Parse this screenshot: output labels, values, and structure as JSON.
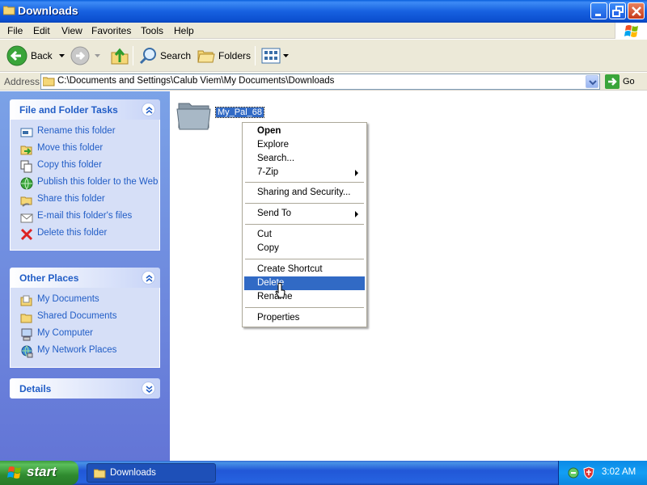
{
  "window": {
    "title": "Downloads",
    "buttons": {
      "minimize": "minimize-icon",
      "maximize": "restore-icon",
      "close": "close-icon"
    }
  },
  "menubar": {
    "items": [
      "File",
      "Edit",
      "View",
      "Favorites",
      "Tools",
      "Help"
    ]
  },
  "toolbar": {
    "back_label": "Back",
    "search_label": "Search",
    "folders_label": "Folders"
  },
  "address": {
    "label": "Address",
    "value": "C:\\Documents and Settings\\Calub Viem\\My Documents\\Downloads",
    "go_label": "Go"
  },
  "tasks": {
    "file_folder": {
      "title": "File and Folder Tasks",
      "items": [
        {
          "label": "Rename this folder",
          "icon": "rename-icon"
        },
        {
          "label": "Move this folder",
          "icon": "move-icon"
        },
        {
          "label": "Copy this folder",
          "icon": "copy-icon"
        },
        {
          "label": "Publish this folder to the Web",
          "icon": "globe-icon"
        },
        {
          "label": "Share this folder",
          "icon": "share-icon"
        },
        {
          "label": "E-mail this folder's files",
          "icon": "email-icon"
        },
        {
          "label": "Delete this folder",
          "icon": "delete-icon"
        }
      ]
    },
    "other_places": {
      "title": "Other Places",
      "items": [
        {
          "label": "My Documents",
          "icon": "folder-icon"
        },
        {
          "label": "Shared Documents",
          "icon": "folder-icon"
        },
        {
          "label": "My Computer",
          "icon": "computer-icon"
        },
        {
          "label": "My Network Places",
          "icon": "network-icon"
        }
      ]
    },
    "details": {
      "title": "Details"
    }
  },
  "content": {
    "folder_name": "My_Pal_68"
  },
  "context_menu": {
    "items": {
      "open": "Open",
      "explore": "Explore",
      "search": "Search...",
      "sevenzip": "7-Zip",
      "sharing": "Sharing and Security...",
      "sendto": "Send To",
      "cut": "Cut",
      "copy": "Copy",
      "create_shortcut": "Create Shortcut",
      "delete": "Delete",
      "rename": "Rename",
      "properties": "Properties"
    },
    "highlighted": "Delete"
  },
  "taskbar": {
    "start_label": "start",
    "window_button": "Downloads",
    "clock": "3:02 AM"
  },
  "colors": {
    "titlebar": "#0a5fdc",
    "taskpane": "#6f8ee0",
    "link": "#215dc6",
    "selection": "#316ac5"
  }
}
